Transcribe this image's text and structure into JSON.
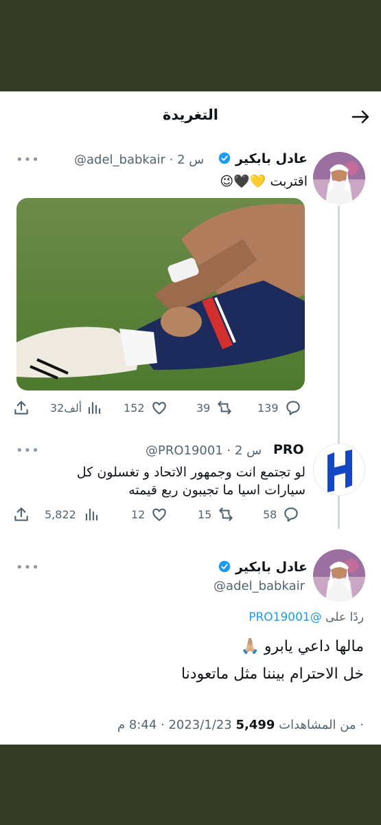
{
  "header": {
    "title": "التغريدة"
  },
  "tweet1": {
    "name": "عادل بابكير",
    "handle_time": "@adel_babkair · 2 س",
    "text": "اقتربت 💛🖤😉",
    "actions": {
      "replies": "139",
      "retweets": "39",
      "likes": "152",
      "views": "32ألف"
    }
  },
  "tweet2": {
    "name": "PRO",
    "handle_time": "@PRO19001 · 2 س",
    "text_line1": "لو تجتمع انت وجمهور الاتحاد و تغسلون كل",
    "text_line2": "سيارات اسيا ما تجيبون ربع قيمته",
    "actions": {
      "replies": "58",
      "retweets": "15",
      "likes": "12",
      "views": "5,822"
    }
  },
  "tweet3": {
    "name": "عادل بابكير",
    "handle": "@adel_babkair",
    "reply_prefix": "ردًا على",
    "reply_handle": "@PRO19001",
    "text_line1": "مالها داعي يابرو 🙏🏼",
    "text_line2": "خل الاحترام بيننا مثل ماتعودنا",
    "meta_date": "2023/1/23 · 8:44 م · ",
    "meta_views": "5,499",
    "meta_suffix": " من المشاهدات"
  },
  "colors": {
    "accent": "#1d9bf0",
    "background": "#333b26",
    "muted": "#536471"
  },
  "icons": [
    "back-arrow-icon",
    "more-icon",
    "verified-icon",
    "reply-icon",
    "retweet-icon",
    "like-icon",
    "views-icon",
    "share-icon"
  ]
}
